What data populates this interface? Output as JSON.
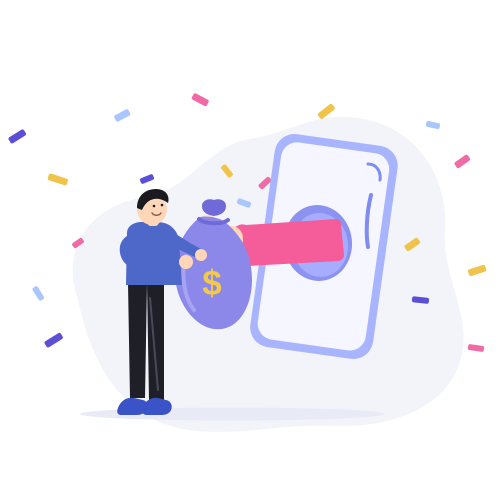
{
  "illustration": {
    "money_symbol": "$"
  },
  "colors": {
    "background": "#ffffff",
    "blob": "#f3f4fa",
    "phone_body": "#a9b4ff",
    "phone_screen": "#f5f6ff",
    "phone_frame": "#7f8cf0",
    "money_bag": "#8c88ea",
    "money_bag_dark": "#6f6ad8",
    "dollar_sign": "#f2c94c",
    "sleeve_pink": "#f45d9a",
    "shirt_blue": "#4d68c9",
    "pants_black": "#1f1f28",
    "shoe_blue": "#3a54c7",
    "skin": "#ffd6b8",
    "hair": "#1b1b1f",
    "confetti_purple": "#5b4fd6",
    "confetti_yellow": "#f0c34a",
    "confetti_pink": "#f06aa5",
    "confetti_blue": "#a9c6ff"
  },
  "icons": [
    "money-bag-icon",
    "dollar-sign-icon",
    "smartphone-icon",
    "hand-icon",
    "confetti-icon"
  ]
}
